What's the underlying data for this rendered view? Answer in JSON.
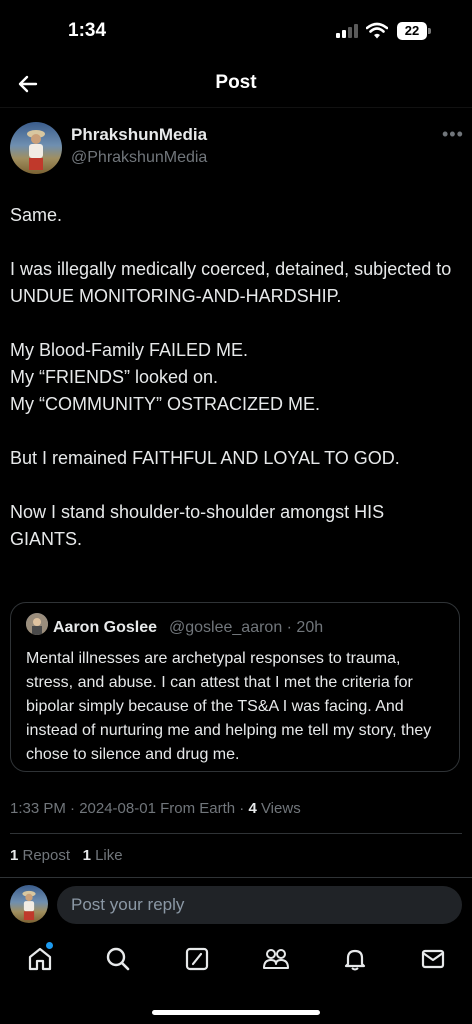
{
  "status_bar": {
    "time": "1:34",
    "battery": "22"
  },
  "header": {
    "title": "Post"
  },
  "post": {
    "author_name": "PhrakshunMedia",
    "author_handle": "@PhrakshunMedia",
    "paragraphs": [
      "Same.",
      "I was illegally medically coerced, detained, subjected to UNDUE MONITORING-AND-HARDSHIP.",
      "My Blood-Family FAILED ME.\nMy “FRIENDS” looked on.\nMy “COMMUNITY” OSTRACIZED ME.",
      "But I remained FAITHFUL AND LOYAL TO GOD.",
      "Now I stand shoulder-to-shoulder amongst HIS GIANTS."
    ],
    "timestamp": "1:33 PM · 2024-08-01 From Earth · ",
    "views_count": "4",
    "views_label": " Views",
    "repost_count": "1",
    "repost_label": " Repost",
    "like_count": "1",
    "like_label": " Like"
  },
  "quote": {
    "name": "Aaron Goslee",
    "handle": "@goslee_aaron · 20h",
    "text": "Mental illnesses are archetypal responses to trauma, stress, and abuse. I can attest that I met the criteria for bipolar simply because of the TS&A I was facing. And instead of nurturing me and helping me tell my story, they chose to silence and drug me."
  },
  "reply": {
    "placeholder": "Post your reply"
  },
  "tabs": [
    "home-icon",
    "search-icon",
    "grok-icon",
    "communities-icon",
    "notifications-icon",
    "messages-icon"
  ],
  "colors": {
    "accent": "#1d9bf0",
    "secondary_text": "#71767b",
    "border": "#2f3336"
  }
}
